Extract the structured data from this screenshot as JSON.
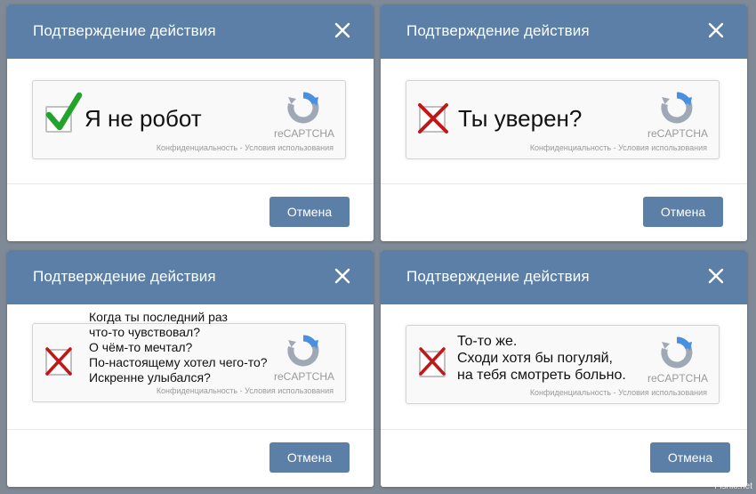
{
  "colors": {
    "header_bg": "#5b7fa6",
    "button_bg": "#5b7fa6",
    "check_green": "#22a329",
    "cross_red": "#c01818",
    "recaptcha_blue": "#4a90e2"
  },
  "dialogs": [
    {
      "title": "Подтверждение действия",
      "close_icon": "close-icon",
      "checkbox_state": "checked",
      "captcha_text": "Я не робот",
      "recaptcha_label": "reCAPTCHA",
      "privacy_text": "Конфиденциальность - Условия использования",
      "cancel_label": "Отмена"
    },
    {
      "title": "Подтверждение действия",
      "close_icon": "close-icon",
      "checkbox_state": "crossed",
      "captcha_text": "Ты уверен?",
      "recaptcha_label": "reCAPTCHA",
      "privacy_text": "Конфиденциальность - Условия использования",
      "cancel_label": "Отмена"
    },
    {
      "title": "Подтверждение действия",
      "close_icon": "close-icon",
      "checkbox_state": "crossed",
      "captcha_lines": [
        "Когда ты последний раз",
        "что-то чувствовал?",
        "О чём-то мечтал?",
        "По-настоящему хотел чего-то?",
        "Искренне улыбался?"
      ],
      "recaptcha_label": "reCAPTCHA",
      "privacy_text": "Конфиденциальность - Условия использования",
      "cancel_label": "Отмена"
    },
    {
      "title": "Подтверждение действия",
      "close_icon": "close-icon",
      "checkbox_state": "crossed",
      "captcha_lines": [
        "То-то же.",
        "Сходи хотя бы погуляй,",
        "на тебя смотреть больно."
      ],
      "recaptcha_label": "reCAPTCHA",
      "privacy_text": "Конфиденциальность - Условия использования",
      "cancel_label": "Отмена"
    }
  ],
  "watermark": "Fishki.net"
}
